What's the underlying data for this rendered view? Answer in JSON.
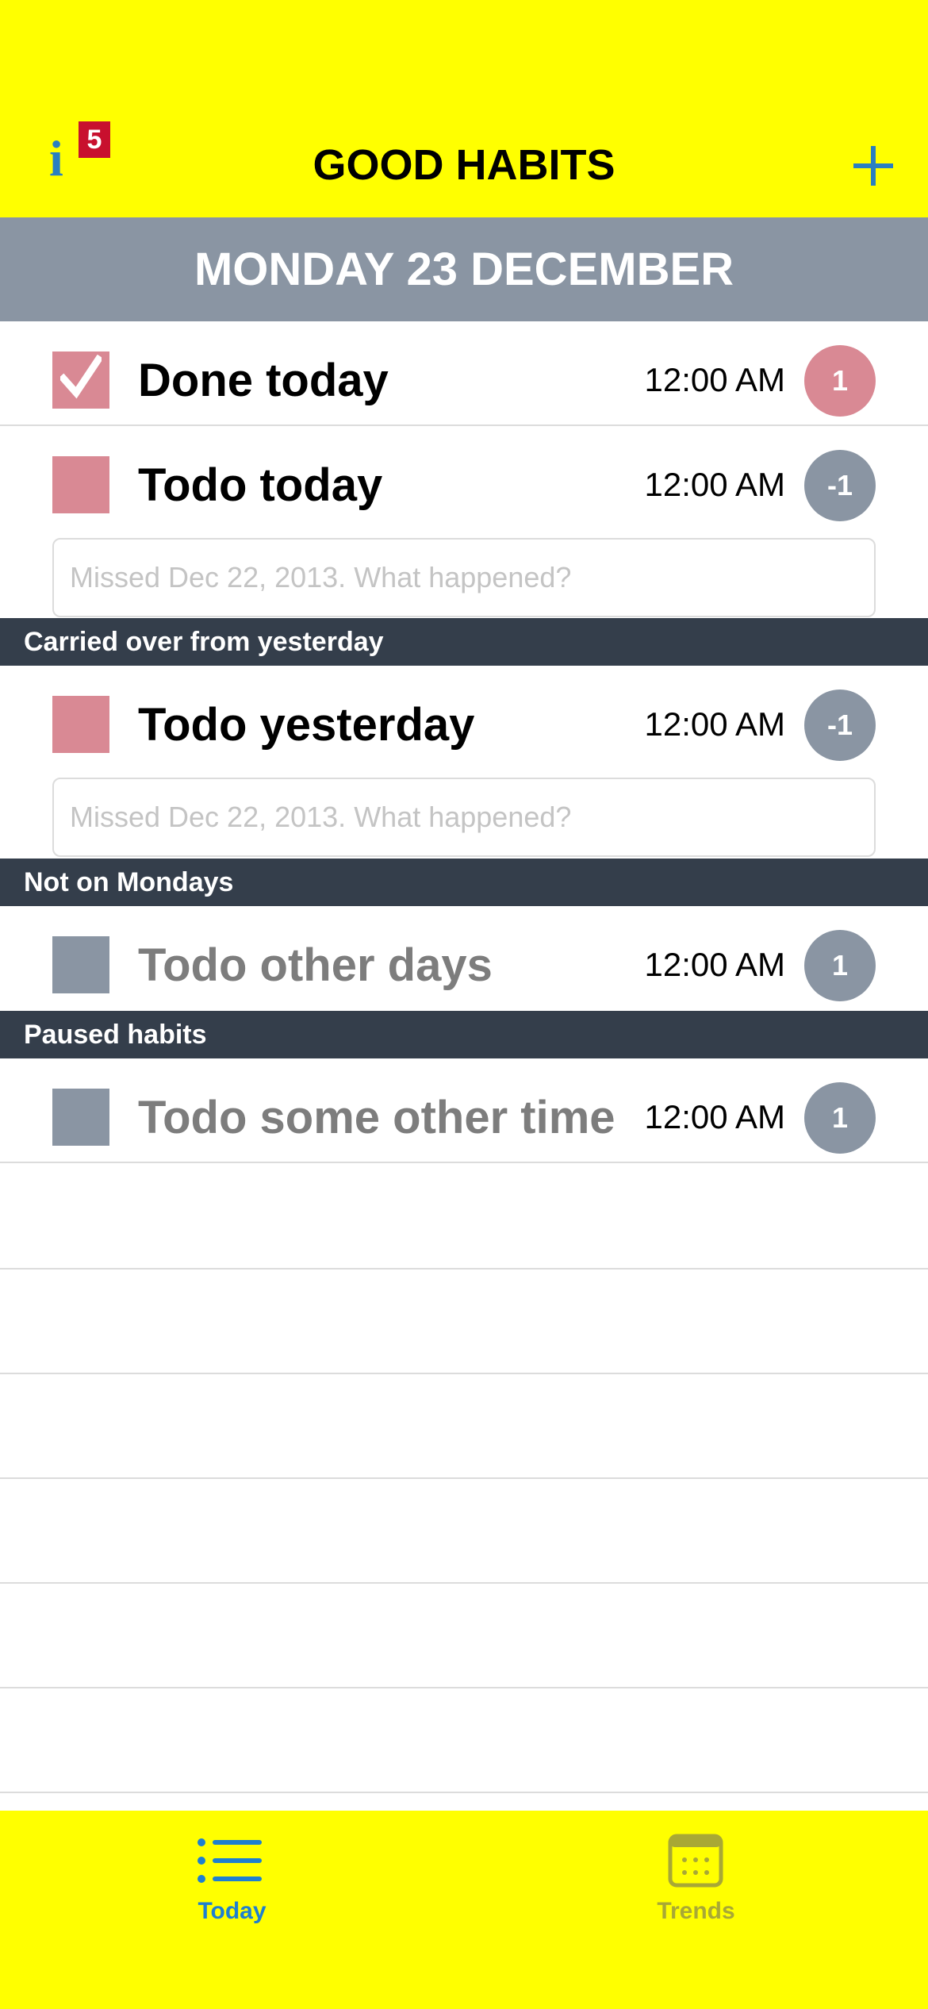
{
  "header": {
    "title": "GOOD HABITS",
    "info_glyph": "i",
    "info_badge": "5",
    "add_icon": "plus-icon"
  },
  "date": "MONDAY 23 DECEMBER",
  "habits_today": [
    {
      "name": "Done today",
      "time": "12:00 AM",
      "streak": "1",
      "checked": true
    },
    {
      "name": "Todo today",
      "time": "12:00 AM",
      "streak": "-1",
      "checked": false,
      "note_placeholder": "Missed Dec 22, 2013. What happened?"
    }
  ],
  "sections": [
    {
      "title": "Carried over from yesterday",
      "habits": [
        {
          "name": "Todo yesterday",
          "time": "12:00 AM",
          "streak": "-1",
          "note_placeholder": "Missed Dec 22, 2013. What happened?"
        }
      ]
    },
    {
      "title": "Not on Mondays",
      "habits": [
        {
          "name": "Todo other days",
          "time": "12:00 AM",
          "streak": "1"
        }
      ]
    },
    {
      "title": "Paused habits",
      "habits": [
        {
          "name": "Todo some other time",
          "time": "12:00 AM",
          "streak": "1"
        }
      ]
    }
  ],
  "tabbar": {
    "tabs": [
      {
        "label": "Today",
        "icon": "list-icon",
        "selected": true
      },
      {
        "label": "Trends",
        "icon": "calendar-icon",
        "selected": false
      }
    ]
  },
  "colors": {
    "accent_yellow": "#ffff00",
    "date_header": "#8a95a3",
    "section_header": "#343e4b",
    "done_pink": "#d98994",
    "inactive_gray": "#8a95a3",
    "tab_selected": "#1e7fd0",
    "badge_red": "#c8102e"
  }
}
